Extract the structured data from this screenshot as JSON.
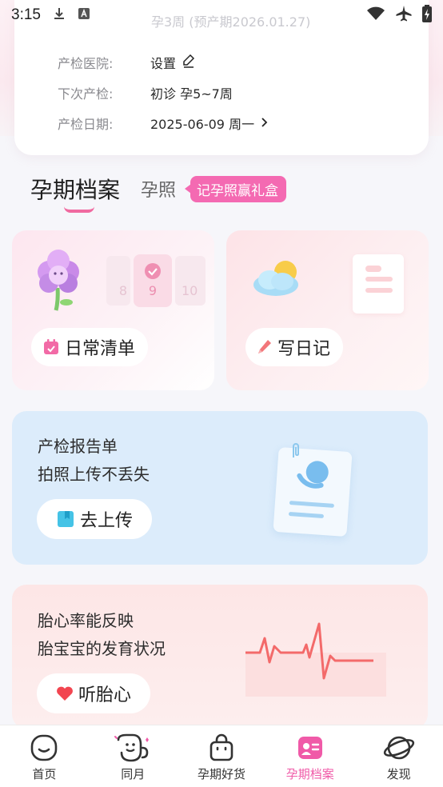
{
  "status_bar": {
    "time": "3:15"
  },
  "info": {
    "subtitle": "孕3周 (预产期2026.01.27)",
    "rows": [
      {
        "label": "产检医院:",
        "value": "设置"
      },
      {
        "label": "下次产检:",
        "value": "初诊 孕5~7周"
      },
      {
        "label": "产检日期:",
        "value": "2025-06-09 周一"
      }
    ]
  },
  "tabs": {
    "active": "孕期档案",
    "second": "孕照",
    "badge": "记孕照赢礼盒"
  },
  "cards": {
    "daily_list": {
      "label": "日常清单",
      "calendar_days": [
        "8",
        "9",
        "10"
      ]
    },
    "diary": {
      "label": "写日记"
    },
    "report": {
      "line1": "产检报告单",
      "line2": "拍照上传不丢失",
      "button": "去上传"
    },
    "heart": {
      "line1": "胎心率能反映",
      "line2": "胎宝宝的发育状况",
      "button": "听胎心"
    }
  },
  "nav": {
    "items": [
      {
        "label": "首页",
        "icon": "home-face-icon"
      },
      {
        "label": "同月",
        "icon": "same-month-icon"
      },
      {
        "label": "孕期好货",
        "icon": "shopping-bag-icon"
      },
      {
        "label": "孕期档案",
        "icon": "profile-card-icon",
        "active": true
      },
      {
        "label": "发现",
        "icon": "planet-icon"
      }
    ]
  },
  "colors": {
    "accent": "#f05aa8",
    "badge": "#f46ab2",
    "report_bg": "#dcecfb",
    "heart_bg": "#fde6e6"
  }
}
